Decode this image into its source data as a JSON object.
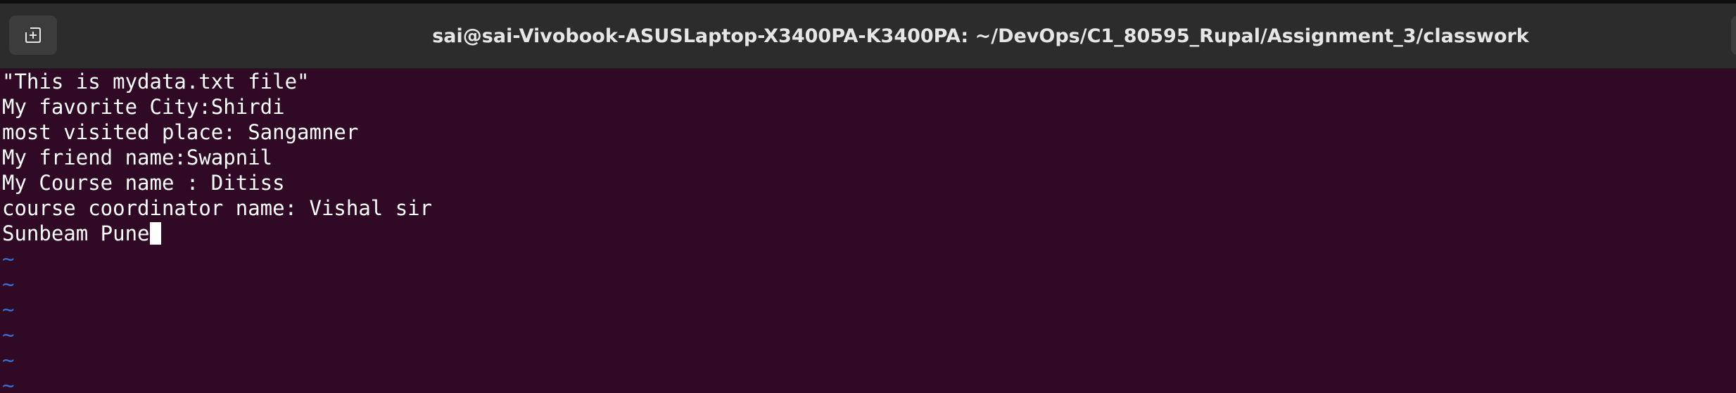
{
  "window": {
    "title": "sai@sai-Vivobook-ASUSLaptop-X3400PA-K3400PA: ~/DevOps/C1_80595_Rupal/Assignment_3/classwork",
    "new_tab_icon": "new-tab-icon"
  },
  "editor": {
    "lines": [
      "\"This is mydata.txt file\"",
      "My favorite City:Shirdi",
      "most visited place: Sangamner",
      "My friend name:Swapnil",
      "My Course name : Ditiss",
      "course coordinator name: Vishal sir",
      "Sunbeam Pune"
    ],
    "empty_line_marker": "~",
    "colors": {
      "background": "#300a24",
      "text": "#ffffff",
      "tilde": "#3b6fd0"
    }
  }
}
